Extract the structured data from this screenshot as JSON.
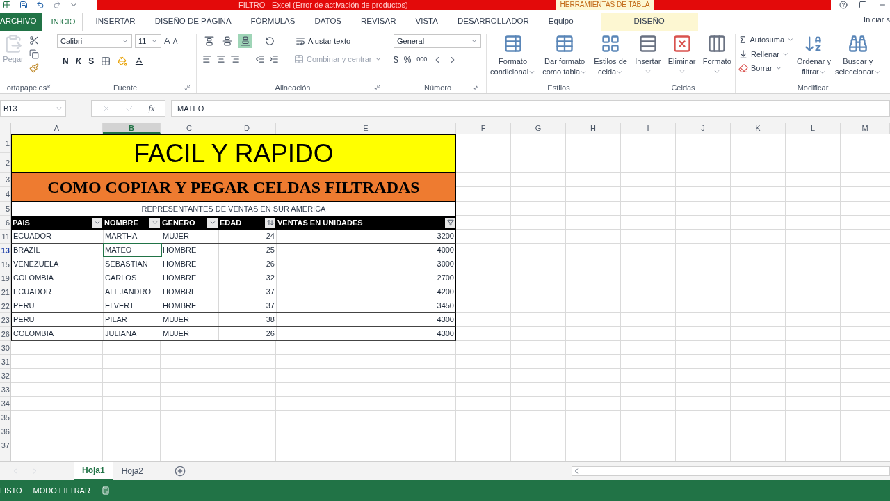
{
  "title_bar": {
    "title": "FILTRO -  Excel (Error de activación de productos)",
    "contextual_tab": "HERRAMIENTAS DE TABLA"
  },
  "ribbon_tabs": [
    {
      "label": "ARCHIVO",
      "kind": "file",
      "selected": false
    },
    {
      "label": "INICIO",
      "kind": "tab",
      "selected": true
    },
    {
      "label": "INSERTAR",
      "kind": "tab",
      "selected": false
    },
    {
      "label": "DISEÑO DE PÁGINA",
      "kind": "tab",
      "selected": false
    },
    {
      "label": "FÓRMULAS",
      "kind": "tab",
      "selected": false
    },
    {
      "label": "DATOS",
      "kind": "tab",
      "selected": false
    },
    {
      "label": "REVISAR",
      "kind": "tab",
      "selected": false
    },
    {
      "label": "VISTA",
      "kind": "tab",
      "selected": false
    },
    {
      "label": "DESARROLLADOR",
      "kind": "tab",
      "selected": false
    },
    {
      "label": "Equipo",
      "kind": "tab",
      "selected": false
    },
    {
      "label": "DISEÑO",
      "kind": "contextual",
      "selected": false
    }
  ],
  "account": "Iniciar s",
  "ribbon": {
    "clipboard": {
      "label": "ortapapeles",
      "paste": "Pegar"
    },
    "font": {
      "label": "Fuente",
      "name": "Calibri",
      "size": "11",
      "grow": "A",
      "shrink": "A",
      "bold": "N",
      "italic": "K",
      "underline": "S"
    },
    "alignment": {
      "label": "Alineación",
      "wrap": "Ajustar texto",
      "merge": "Combinar y centrar",
      "vertical": [
        {
          "selected": false
        },
        {
          "selected": false
        },
        {
          "selected": true
        }
      ]
    },
    "number": {
      "label": "Número",
      "format": "General",
      "currency": "$",
      "percent": "%",
      "thousands": "000"
    },
    "styles": {
      "label": "Estilos",
      "buttons": [
        {
          "lines": [
            "Formato",
            "condicional"
          ]
        },
        {
          "lines": [
            "Dar formato",
            "como tabla"
          ]
        },
        {
          "lines": [
            "Estilos de",
            "celda"
          ]
        }
      ]
    },
    "cells": {
      "label": "Celdas",
      "buttons": [
        {
          "lines": [
            "Insertar"
          ]
        },
        {
          "lines": [
            "Eliminar"
          ]
        },
        {
          "lines": [
            "Formato"
          ]
        }
      ]
    },
    "editing": {
      "label": "Modificar",
      "items": [
        "Autosuma",
        "Rellenar",
        "Borrar"
      ],
      "buttons": [
        {
          "lines": [
            "Ordenar y",
            "filtrar"
          ]
        },
        {
          "lines": [
            "Buscar y",
            "seleccionar"
          ]
        }
      ]
    }
  },
  "formula_bar": {
    "name_box": "B13",
    "function_label": "fx",
    "formula": "MATEO"
  },
  "columns": [
    {
      "label": "A",
      "selected": false
    },
    {
      "label": "B",
      "selected": true
    },
    {
      "label": "C",
      "selected": false
    },
    {
      "label": "D",
      "selected": false
    },
    {
      "label": "E",
      "selected": false
    },
    {
      "label": "F",
      "selected": false
    },
    {
      "label": "G",
      "selected": false
    },
    {
      "label": "H",
      "selected": false
    },
    {
      "label": "I",
      "selected": false
    },
    {
      "label": "J",
      "selected": false
    },
    {
      "label": "K",
      "selected": false
    },
    {
      "label": "L",
      "selected": false
    },
    {
      "label": "M",
      "selected": false
    }
  ],
  "row_headers": [
    {
      "label": "1",
      "selected": false
    },
    {
      "label": "2",
      "selected": false
    },
    {
      "label": "3",
      "selected": false
    },
    {
      "label": "4",
      "selected": false
    },
    {
      "label": "5",
      "selected": false
    },
    {
      "label": "6",
      "selected": false
    },
    {
      "label": "11",
      "selected": false
    },
    {
      "label": "13",
      "selected": true
    },
    {
      "label": "15",
      "selected": false
    },
    {
      "label": "19",
      "selected": false
    },
    {
      "label": "21",
      "selected": false
    },
    {
      "label": "22",
      "selected": false
    },
    {
      "label": "23",
      "selected": false
    },
    {
      "label": "26",
      "selected": false
    },
    {
      "label": "30",
      "selected": false
    },
    {
      "label": "31",
      "selected": false
    },
    {
      "label": "32",
      "selected": false
    },
    {
      "label": "33",
      "selected": false
    },
    {
      "label": "34",
      "selected": false
    },
    {
      "label": "35",
      "selected": false
    },
    {
      "label": "36",
      "selected": false
    },
    {
      "label": "37",
      "selected": false
    }
  ],
  "banner": {
    "title": "FACIL Y RAPIDO",
    "subtitle": "COMO COPIAR Y PEGAR CELDAS FILTRADAS",
    "caption": "REPRESENTANTES DE VENTAS EN SUR AMERICA"
  },
  "table": {
    "headers": [
      {
        "label": "PAIS",
        "kind": "dropdown"
      },
      {
        "label": "NOMBRE",
        "kind": "dropdown"
      },
      {
        "label": "GENERO",
        "kind": "dropdown"
      },
      {
        "label": "EDAD",
        "kind": "sorted"
      },
      {
        "label": "VENTAS EN UNIDADES",
        "kind": "filtered"
      }
    ],
    "rows": [
      [
        "ECUADOR",
        "MARTHA",
        "MUJER",
        "24",
        "3200"
      ],
      [
        "BRAZIL",
        "MATEO",
        "HOMBRE",
        "25",
        "4000"
      ],
      [
        "VENEZUELA",
        "SEBASTIAN",
        "HOMBRE",
        "26",
        "3000"
      ],
      [
        "COLOMBIA",
        "CARLOS",
        "HOMBRE",
        "32",
        "2700"
      ],
      [
        "ECUADOR",
        "ALEJANDRO",
        "HOMBRE",
        "37",
        "4200"
      ],
      [
        "PERU",
        "ELVERT",
        "HOMBRE",
        "37",
        "3450"
      ],
      [
        "PERU",
        "PILAR",
        "MUJER",
        "38",
        "4300"
      ],
      [
        "COLOMBIA",
        "JULIANA",
        "MUJER",
        "26",
        "4300"
      ]
    ]
  },
  "sheets": [
    {
      "label": "Hoja1",
      "selected": true
    },
    {
      "label": "Hoja2",
      "selected": false
    }
  ],
  "status_bar": {
    "items": [
      "LISTO",
      "MODO FILTRAR"
    ]
  }
}
